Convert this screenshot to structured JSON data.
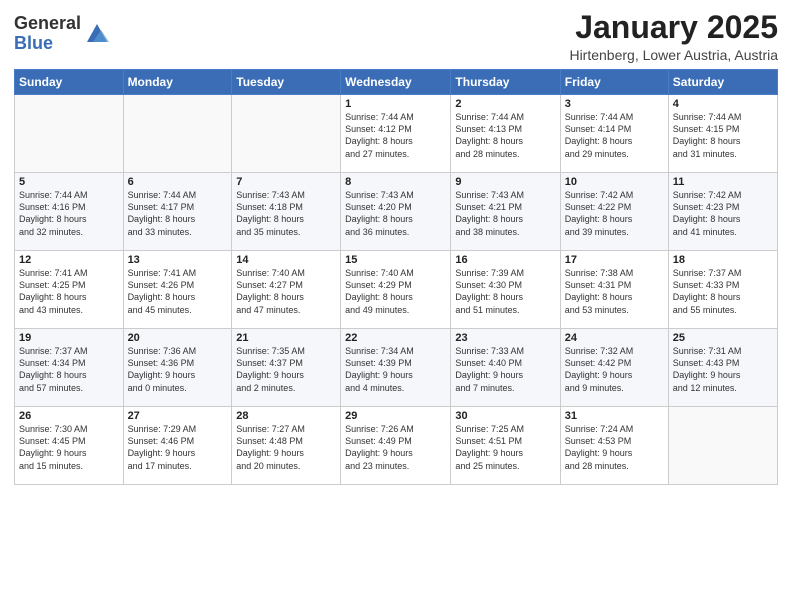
{
  "logo": {
    "general": "General",
    "blue": "Blue"
  },
  "header": {
    "month": "January 2025",
    "location": "Hirtenberg, Lower Austria, Austria"
  },
  "days_of_week": [
    "Sunday",
    "Monday",
    "Tuesday",
    "Wednesday",
    "Thursday",
    "Friday",
    "Saturday"
  ],
  "weeks": [
    [
      {
        "day": "",
        "sunrise": "",
        "sunset": "",
        "daylight": ""
      },
      {
        "day": "",
        "sunrise": "",
        "sunset": "",
        "daylight": ""
      },
      {
        "day": "",
        "sunrise": "",
        "sunset": "",
        "daylight": ""
      },
      {
        "day": "1",
        "sunrise": "Sunrise: 7:44 AM",
        "sunset": "Sunset: 4:12 PM",
        "daylight": "Daylight: 8 hours and 27 minutes."
      },
      {
        "day": "2",
        "sunrise": "Sunrise: 7:44 AM",
        "sunset": "Sunset: 4:13 PM",
        "daylight": "Daylight: 8 hours and 28 minutes."
      },
      {
        "day": "3",
        "sunrise": "Sunrise: 7:44 AM",
        "sunset": "Sunset: 4:14 PM",
        "daylight": "Daylight: 8 hours and 29 minutes."
      },
      {
        "day": "4",
        "sunrise": "Sunrise: 7:44 AM",
        "sunset": "Sunset: 4:15 PM",
        "daylight": "Daylight: 8 hours and 31 minutes."
      }
    ],
    [
      {
        "day": "5",
        "sunrise": "Sunrise: 7:44 AM",
        "sunset": "Sunset: 4:16 PM",
        "daylight": "Daylight: 8 hours and 32 minutes."
      },
      {
        "day": "6",
        "sunrise": "Sunrise: 7:44 AM",
        "sunset": "Sunset: 4:17 PM",
        "daylight": "Daylight: 8 hours and 33 minutes."
      },
      {
        "day": "7",
        "sunrise": "Sunrise: 7:43 AM",
        "sunset": "Sunset: 4:18 PM",
        "daylight": "Daylight: 8 hours and 35 minutes."
      },
      {
        "day": "8",
        "sunrise": "Sunrise: 7:43 AM",
        "sunset": "Sunset: 4:20 PM",
        "daylight": "Daylight: 8 hours and 36 minutes."
      },
      {
        "day": "9",
        "sunrise": "Sunrise: 7:43 AM",
        "sunset": "Sunset: 4:21 PM",
        "daylight": "Daylight: 8 hours and 38 minutes."
      },
      {
        "day": "10",
        "sunrise": "Sunrise: 7:42 AM",
        "sunset": "Sunset: 4:22 PM",
        "daylight": "Daylight: 8 hours and 39 minutes."
      },
      {
        "day": "11",
        "sunrise": "Sunrise: 7:42 AM",
        "sunset": "Sunset: 4:23 PM",
        "daylight": "Daylight: 8 hours and 41 minutes."
      }
    ],
    [
      {
        "day": "12",
        "sunrise": "Sunrise: 7:41 AM",
        "sunset": "Sunset: 4:25 PM",
        "daylight": "Daylight: 8 hours and 43 minutes."
      },
      {
        "day": "13",
        "sunrise": "Sunrise: 7:41 AM",
        "sunset": "Sunset: 4:26 PM",
        "daylight": "Daylight: 8 hours and 45 minutes."
      },
      {
        "day": "14",
        "sunrise": "Sunrise: 7:40 AM",
        "sunset": "Sunset: 4:27 PM",
        "daylight": "Daylight: 8 hours and 47 minutes."
      },
      {
        "day": "15",
        "sunrise": "Sunrise: 7:40 AM",
        "sunset": "Sunset: 4:29 PM",
        "daylight": "Daylight: 8 hours and 49 minutes."
      },
      {
        "day": "16",
        "sunrise": "Sunrise: 7:39 AM",
        "sunset": "Sunset: 4:30 PM",
        "daylight": "Daylight: 8 hours and 51 minutes."
      },
      {
        "day": "17",
        "sunrise": "Sunrise: 7:38 AM",
        "sunset": "Sunset: 4:31 PM",
        "daylight": "Daylight: 8 hours and 53 minutes."
      },
      {
        "day": "18",
        "sunrise": "Sunrise: 7:37 AM",
        "sunset": "Sunset: 4:33 PM",
        "daylight": "Daylight: 8 hours and 55 minutes."
      }
    ],
    [
      {
        "day": "19",
        "sunrise": "Sunrise: 7:37 AM",
        "sunset": "Sunset: 4:34 PM",
        "daylight": "Daylight: 8 hours and 57 minutes."
      },
      {
        "day": "20",
        "sunrise": "Sunrise: 7:36 AM",
        "sunset": "Sunset: 4:36 PM",
        "daylight": "Daylight: 9 hours and 0 minutes."
      },
      {
        "day": "21",
        "sunrise": "Sunrise: 7:35 AM",
        "sunset": "Sunset: 4:37 PM",
        "daylight": "Daylight: 9 hours and 2 minutes."
      },
      {
        "day": "22",
        "sunrise": "Sunrise: 7:34 AM",
        "sunset": "Sunset: 4:39 PM",
        "daylight": "Daylight: 9 hours and 4 minutes."
      },
      {
        "day": "23",
        "sunrise": "Sunrise: 7:33 AM",
        "sunset": "Sunset: 4:40 PM",
        "daylight": "Daylight: 9 hours and 7 minutes."
      },
      {
        "day": "24",
        "sunrise": "Sunrise: 7:32 AM",
        "sunset": "Sunset: 4:42 PM",
        "daylight": "Daylight: 9 hours and 9 minutes."
      },
      {
        "day": "25",
        "sunrise": "Sunrise: 7:31 AM",
        "sunset": "Sunset: 4:43 PM",
        "daylight": "Daylight: 9 hours and 12 minutes."
      }
    ],
    [
      {
        "day": "26",
        "sunrise": "Sunrise: 7:30 AM",
        "sunset": "Sunset: 4:45 PM",
        "daylight": "Daylight: 9 hours and 15 minutes."
      },
      {
        "day": "27",
        "sunrise": "Sunrise: 7:29 AM",
        "sunset": "Sunset: 4:46 PM",
        "daylight": "Daylight: 9 hours and 17 minutes."
      },
      {
        "day": "28",
        "sunrise": "Sunrise: 7:27 AM",
        "sunset": "Sunset: 4:48 PM",
        "daylight": "Daylight: 9 hours and 20 minutes."
      },
      {
        "day": "29",
        "sunrise": "Sunrise: 7:26 AM",
        "sunset": "Sunset: 4:49 PM",
        "daylight": "Daylight: 9 hours and 23 minutes."
      },
      {
        "day": "30",
        "sunrise": "Sunrise: 7:25 AM",
        "sunset": "Sunset: 4:51 PM",
        "daylight": "Daylight: 9 hours and 25 minutes."
      },
      {
        "day": "31",
        "sunrise": "Sunrise: 7:24 AM",
        "sunset": "Sunset: 4:53 PM",
        "daylight": "Daylight: 9 hours and 28 minutes."
      },
      {
        "day": "",
        "sunrise": "",
        "sunset": "",
        "daylight": ""
      }
    ]
  ]
}
